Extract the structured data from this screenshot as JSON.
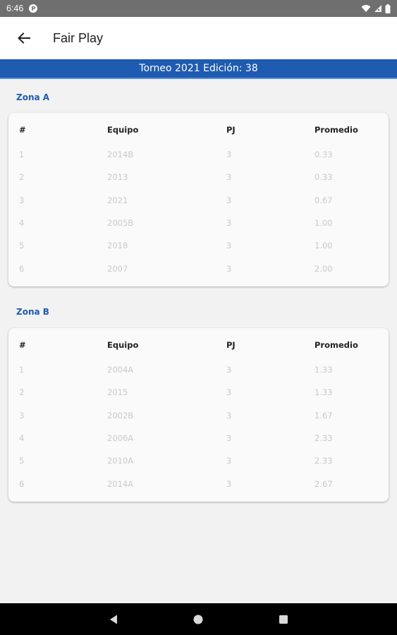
{
  "status_bar": {
    "time": "6:46",
    "app_icon": "P"
  },
  "app_bar": {
    "title": "Fair Play",
    "back_icon": "arrow-left-icon"
  },
  "banner": {
    "text": "Torneo 2021 Edición: 38"
  },
  "colors": {
    "primary": "#1f5bb0",
    "status_bar": "#6f6f6f",
    "background": "#f2f2f2",
    "card": "#fafafa",
    "header_text": "#222222",
    "data_text": "#c9c9c9"
  },
  "columns": [
    "#",
    "Equipo",
    "PJ",
    "Promedio"
  ],
  "zones": [
    {
      "title": "Zona A",
      "rows": [
        [
          "1",
          "2014B",
          "3",
          "0.33"
        ],
        [
          "2",
          "2013",
          "3",
          "0.33"
        ],
        [
          "3",
          "2021",
          "3",
          "0.67"
        ],
        [
          "4",
          "2005B",
          "3",
          "1.00"
        ],
        [
          "5",
          "2018",
          "3",
          "1.00"
        ],
        [
          "6",
          "2007",
          "3",
          "2.00"
        ]
      ]
    },
    {
      "title": "Zona B",
      "rows": [
        [
          "1",
          "2004A",
          "3",
          "1.33"
        ],
        [
          "2",
          "2015",
          "3",
          "1.33"
        ],
        [
          "3",
          "2002B",
          "3",
          "1.67"
        ],
        [
          "4",
          "2006A",
          "3",
          "2.33"
        ],
        [
          "5",
          "2010A",
          "3",
          "2.33"
        ],
        [
          "6",
          "2014A",
          "3",
          "2.67"
        ]
      ]
    }
  ],
  "nav_bar": {
    "back_icon": "nav-back-icon",
    "home_icon": "nav-home-icon",
    "recents_icon": "nav-recents-icon"
  }
}
